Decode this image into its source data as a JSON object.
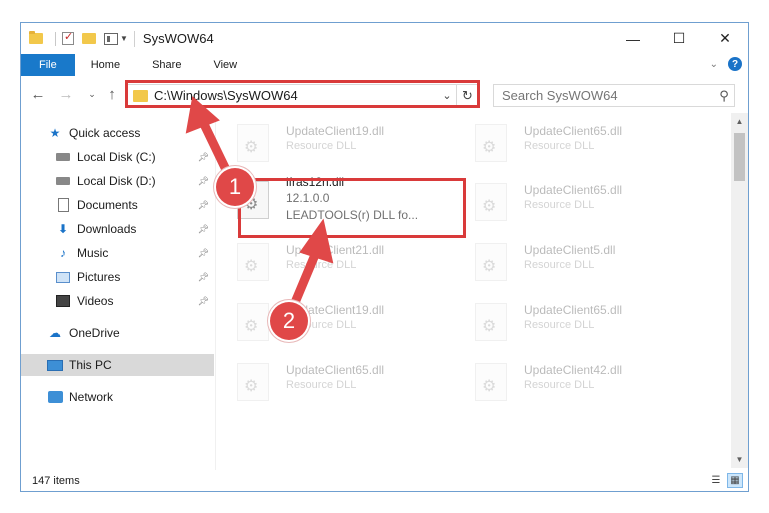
{
  "window": {
    "title": "SysWOW64",
    "controls": {
      "minimize": "—",
      "maximize": "☐",
      "close": "✕"
    }
  },
  "ribbon": {
    "tabs": [
      "File",
      "Home",
      "Share",
      "View"
    ],
    "help": "?"
  },
  "address": {
    "path": "C:\\Windows\\SysWOW64",
    "search_placeholder": "Search SysWOW64"
  },
  "nav": {
    "items": [
      {
        "label": "Quick access",
        "icon": "star-icon"
      },
      {
        "label": "Local Disk (C:)",
        "icon": "drive-icon"
      },
      {
        "label": "Local Disk (D:)",
        "icon": "drive-icon"
      },
      {
        "label": "Documents",
        "icon": "documents-icon"
      },
      {
        "label": "Downloads",
        "icon": "downloads-icon"
      },
      {
        "label": "Music",
        "icon": "music-icon"
      },
      {
        "label": "Pictures",
        "icon": "pictures-icon"
      },
      {
        "label": "Videos",
        "icon": "videos-icon"
      },
      {
        "label": "OneDrive",
        "icon": "onedrive-icon"
      },
      {
        "label": "This PC",
        "icon": "computer-icon"
      },
      {
        "label": "Network",
        "icon": "network-icon"
      }
    ]
  },
  "files": {
    "highlighted": {
      "name": "lfras12n.dll",
      "version": "12.1.0.0",
      "description": "LEADTOOLS(r) DLL fo..."
    },
    "faded": [
      {
        "name": "UpdateClient19.dll",
        "type": "Resource DLL"
      },
      {
        "name": "UpdateClient65.dll",
        "type": "Resource DLL"
      },
      {
        "name": "UpdateClient65.dll",
        "type": "Resource DLL"
      },
      {
        "name": "UpdateClient21.dll",
        "type": "Resource DLL"
      },
      {
        "name": "UpdateClient5.dll",
        "type": "Resource DLL"
      },
      {
        "name": "UpdateClient19.dll",
        "type": "Resource DLL"
      },
      {
        "name": "UpdateClient65.dll",
        "type": "Resource DLL"
      },
      {
        "name": "UpdateClient65.dll",
        "type": "Resource DLL"
      },
      {
        "name": "UpdateClient42.dll",
        "type": "Resource DLL"
      }
    ]
  },
  "status": {
    "item_count": "147 items"
  },
  "annotations": {
    "step1": "1",
    "step2": "2"
  },
  "colors": {
    "accent": "#1979ca",
    "annotation": "#d93a3a"
  }
}
